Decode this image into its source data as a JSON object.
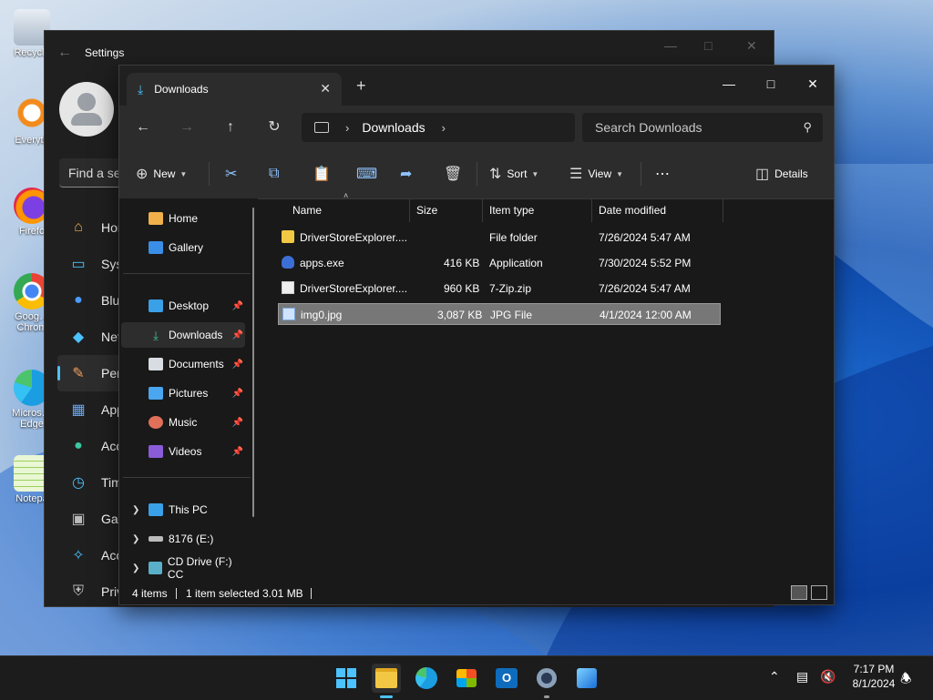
{
  "desktop": {
    "icons": [
      {
        "label": "Recycle"
      },
      {
        "label": "Everyth"
      },
      {
        "label": "Firefo"
      },
      {
        "label": "Goog… Chrom"
      },
      {
        "label": "Micros… Edge"
      },
      {
        "label": "Notepa"
      }
    ]
  },
  "settings": {
    "title": "Settings",
    "search_placeholder": "Find a se",
    "nav": [
      {
        "label": "Hon",
        "icon": "home-icon"
      },
      {
        "label": "Syst",
        "icon": "monitor-icon"
      },
      {
        "label": "Blue",
        "icon": "bluetooth-icon"
      },
      {
        "label": "Net",
        "icon": "wifi-icon"
      },
      {
        "label": "Pers",
        "icon": "brush-icon",
        "active": true
      },
      {
        "label": "App",
        "icon": "apps-icon"
      },
      {
        "label": "Acc",
        "icon": "accounts-icon"
      },
      {
        "label": "Tim",
        "icon": "clock-icon"
      },
      {
        "label": "Gan",
        "icon": "gamepad-icon"
      },
      {
        "label": "Acc",
        "icon": "accessibility-icon"
      },
      {
        "label": "Priv",
        "icon": "shield-icon"
      }
    ]
  },
  "explorer": {
    "tab_label": "Downloads",
    "address": {
      "crumb": "Downloads"
    },
    "search_placeholder": "Search Downloads",
    "toolbar": {
      "new_label": "New",
      "sort_label": "Sort",
      "view_label": "View",
      "more_label": "⋯",
      "details_label": "Details"
    },
    "sidebar": {
      "top": [
        {
          "label": "Home",
          "icon": "home-icon"
        },
        {
          "label": "Gallery",
          "icon": "gallery-icon"
        }
      ],
      "quick": [
        {
          "label": "Desktop",
          "icon": "desktop-folder-icon"
        },
        {
          "label": "Downloads",
          "icon": "downloads-folder-icon",
          "selected": true
        },
        {
          "label": "Documents",
          "icon": "documents-folder-icon"
        },
        {
          "label": "Pictures",
          "icon": "pictures-folder-icon"
        },
        {
          "label": "Music",
          "icon": "music-folder-icon"
        },
        {
          "label": "Videos",
          "icon": "videos-folder-icon"
        }
      ],
      "drives": [
        {
          "label": "This PC",
          "icon": "this-pc-icon"
        },
        {
          "label": "8176 (E:)",
          "icon": "drive-icon"
        },
        {
          "label": "CD Drive (F:) CC",
          "icon": "cd-drive-icon"
        }
      ]
    },
    "columns": {
      "name": "Name",
      "size": "Size",
      "type": "Item type",
      "date": "Date modified"
    },
    "files": [
      {
        "name": "DriverStoreExplorer....",
        "size": "",
        "type": "File folder",
        "date": "7/26/2024 5:47 AM",
        "icon": "folder-icon"
      },
      {
        "name": "apps.exe",
        "size": "416 KB",
        "type": "Application",
        "date": "7/30/2024 5:52 PM",
        "icon": "exe-icon"
      },
      {
        "name": "DriverStoreExplorer....",
        "size": "960 KB",
        "type": "7-Zip.zip",
        "date": "7/26/2024 5:47 AM",
        "icon": "zip-icon"
      },
      {
        "name": "img0.jpg",
        "size": "3,087 KB",
        "type": "JPG File",
        "date": "4/1/2024 12:00 AM",
        "icon": "jpg-icon",
        "selected": true
      }
    ],
    "status": {
      "items": "4 items",
      "selected": "1 item selected",
      "size": "3.01 MB"
    }
  },
  "taskbar": {
    "clock_time": "7:17 PM",
    "clock_date": "8/1/2024"
  }
}
